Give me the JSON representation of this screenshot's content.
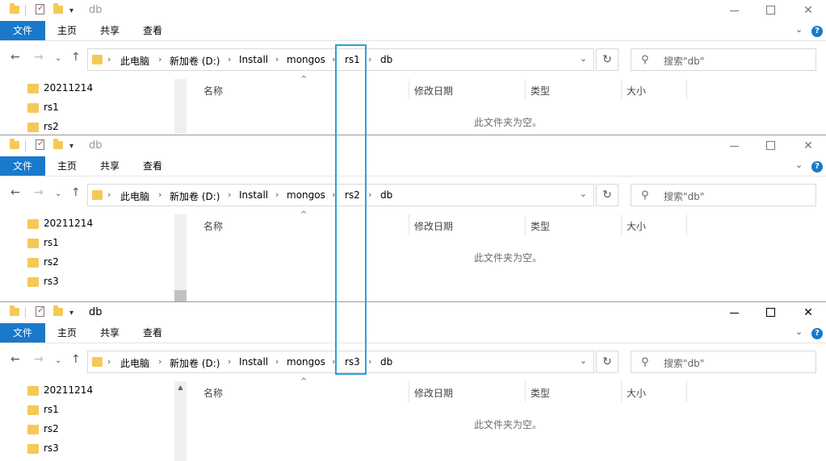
{
  "windows": [
    {
      "title": "db",
      "ribbon": {
        "file": "文件",
        "home": "主页",
        "share": "共享",
        "view": "查看"
      },
      "breadcrumb": [
        "此电脑",
        "新加卷 (D:)",
        "Install",
        "mongos",
        "rs1",
        "db"
      ],
      "search_placeholder": "搜索\"db\"",
      "tree": [
        "20211214",
        "rs1",
        "rs2"
      ],
      "columns": {
        "name": "名称",
        "modified": "修改日期",
        "type": "类型",
        "size": "大小"
      },
      "empty_message": "此文件夹为空。"
    },
    {
      "title": "db",
      "ribbon": {
        "file": "文件",
        "home": "主页",
        "share": "共享",
        "view": "查看"
      },
      "breadcrumb": [
        "此电脑",
        "新加卷 (D:)",
        "Install",
        "mongos",
        "rs2",
        "db"
      ],
      "search_placeholder": "搜索\"db\"",
      "tree": [
        "20211214",
        "rs1",
        "rs2",
        "rs3"
      ],
      "columns": {
        "name": "名称",
        "modified": "修改日期",
        "type": "类型",
        "size": "大小"
      },
      "empty_message": "此文件夹为空。"
    },
    {
      "title": "db",
      "ribbon": {
        "file": "文件",
        "home": "主页",
        "share": "共享",
        "view": "查看"
      },
      "breadcrumb": [
        "此电脑",
        "新加卷 (D:)",
        "Install",
        "mongos",
        "rs3",
        "db"
      ],
      "search_placeholder": "搜索\"db\"",
      "tree": [
        "20211214",
        "rs1",
        "rs2",
        "rs3"
      ],
      "columns": {
        "name": "名称",
        "modified": "修改日期",
        "type": "类型",
        "size": "大小"
      },
      "empty_message": "此文件夹为空。"
    }
  ],
  "icons": {
    "back": "arrow-left-icon",
    "forward": "arrow-right-icon",
    "recent": "chevron-down-icon",
    "up": "arrow-up-icon",
    "refresh": "refresh-icon",
    "search": "search-icon",
    "help": "help-icon",
    "folder": "folder-icon"
  },
  "colors": {
    "accent": "#1979ca",
    "highlight": "#2aa0d8",
    "folder": "#f5c957"
  }
}
